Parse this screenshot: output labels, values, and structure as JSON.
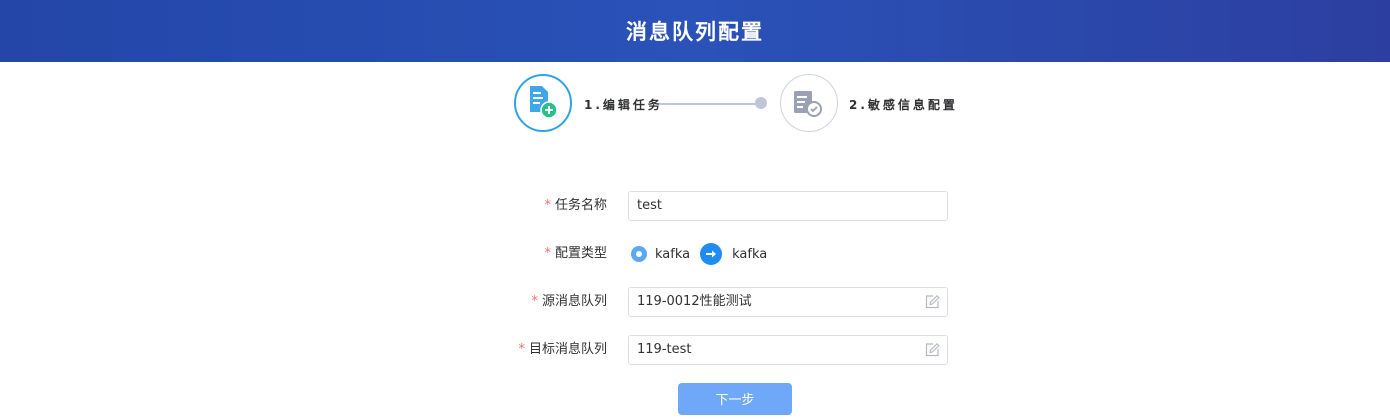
{
  "header": {
    "title": "消息队列配置"
  },
  "steps": [
    {
      "label": "1.编辑任务",
      "icon": "document-add-icon",
      "state": "active"
    },
    {
      "label": "2.敏感信息配置",
      "icon": "document-check-icon",
      "state": "inactive"
    }
  ],
  "form": {
    "required_mark": "*",
    "task_name": {
      "label": "任务名称",
      "value": "test"
    },
    "config_type": {
      "label": "配置类型",
      "source_option": "kafka",
      "target_option": "kafka"
    },
    "source_queue": {
      "label": "源消息队列",
      "value": "119-0012性能测试"
    },
    "target_queue": {
      "label": "目标消息队列",
      "value": "119-test"
    }
  },
  "actions": {
    "next_label": "下一步"
  },
  "colors": {
    "header": "#2346a8",
    "accent": "#1f8cf3",
    "required": "#f56c6c",
    "button": "#6fa8f8"
  }
}
